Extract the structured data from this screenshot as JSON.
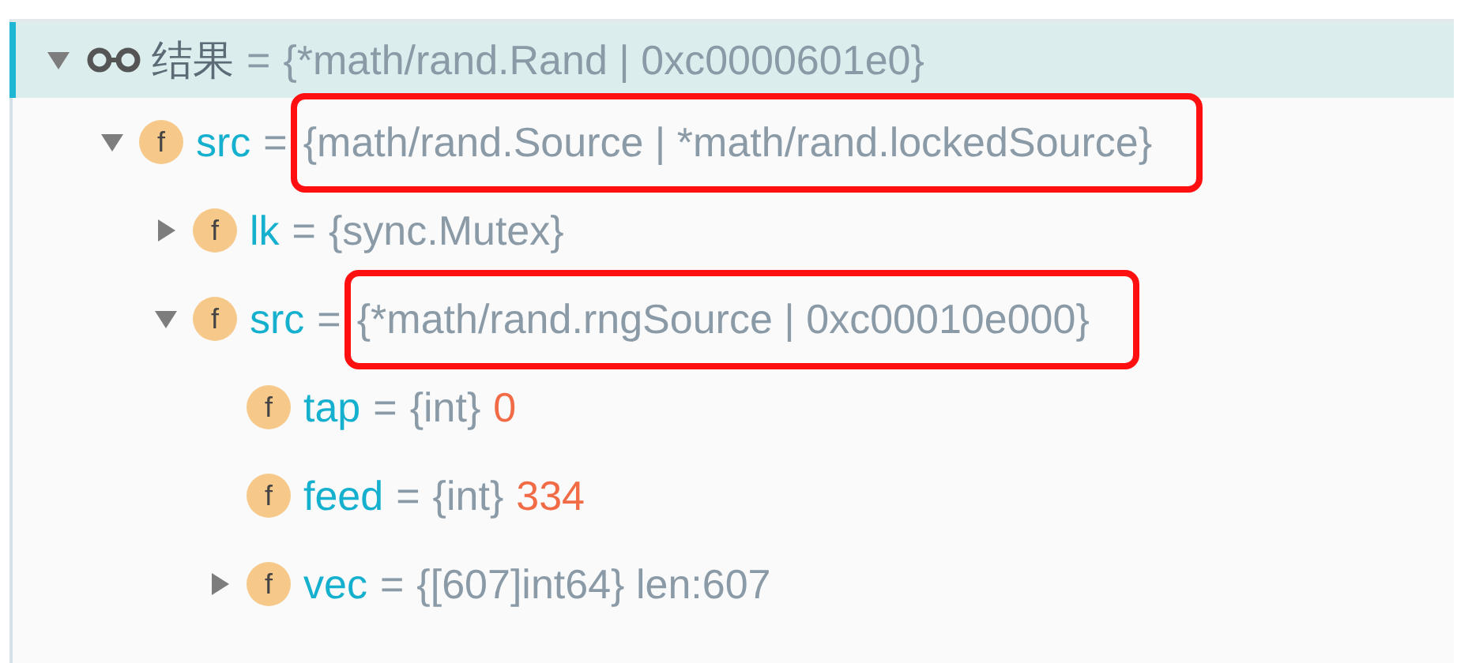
{
  "tree": [
    {
      "kind": "watch",
      "name": "结果",
      "operator": "=",
      "type": "{*math/rand.Rand | 0xc0000601e0}",
      "selected": true,
      "expanded": true,
      "highlighted": false,
      "children": [
        {
          "kind": "field",
          "badge": "f",
          "name": "src",
          "operator": "=",
          "type": "{math/rand.Source | *math/rand.lockedSource}",
          "selected": false,
          "expanded": true,
          "highlighted": true,
          "children": [
            {
              "kind": "field",
              "badge": "f",
              "name": "lk",
              "operator": "=",
              "type": "{sync.Mutex}",
              "selected": false,
              "expanded": false,
              "highlighted": false
            },
            {
              "kind": "field",
              "badge": "f",
              "name": "src",
              "operator": "=",
              "type": "{*math/rand.rngSource | 0xc00010e000}",
              "selected": false,
              "expanded": true,
              "highlighted": true,
              "children": [
                {
                  "kind": "field",
                  "badge": "f",
                  "name": "tap",
                  "operator": "=",
                  "type": "{int}",
                  "value": "0",
                  "selected": false,
                  "highlighted": false
                },
                {
                  "kind": "field",
                  "badge": "f",
                  "name": "feed",
                  "operator": "=",
                  "type": "{int}",
                  "value": "334",
                  "selected": false,
                  "highlighted": false
                },
                {
                  "kind": "field",
                  "badge": "f",
                  "name": "vec",
                  "operator": "=",
                  "type": "{[607]int64} len:607",
                  "selected": false,
                  "expanded": false,
                  "highlighted": false
                }
              ]
            }
          ]
        }
      ]
    }
  ]
}
